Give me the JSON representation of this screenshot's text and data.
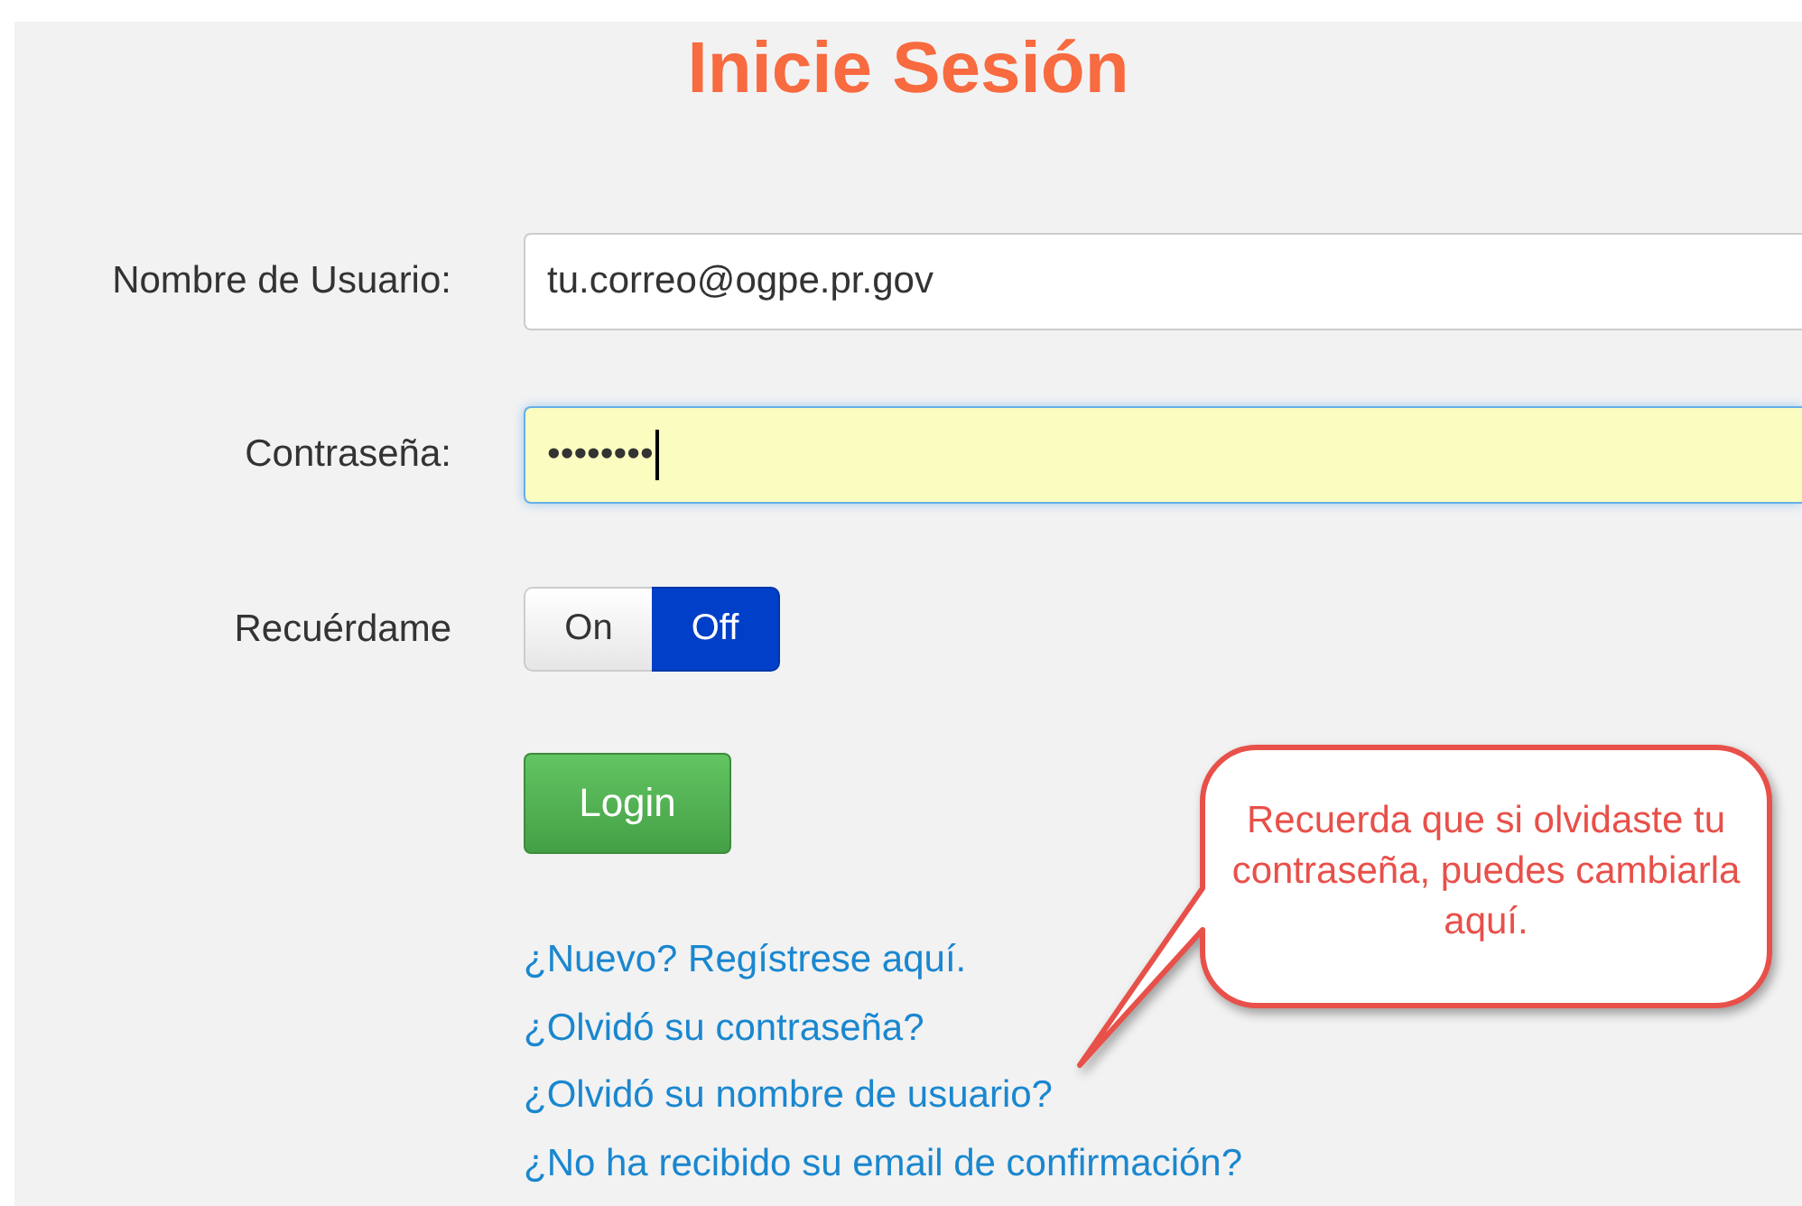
{
  "title": "Inicie Sesión",
  "fields": [
    {
      "label": "Nombre de Usuario:",
      "value": "tu.correo@ogpe.pr.gov",
      "focused": false
    },
    {
      "label": "Contraseña:",
      "value": "••••••••",
      "focused": true
    }
  ],
  "remember": {
    "label": "Recuérdame",
    "options": [
      {
        "label": "On",
        "selected": false
      },
      {
        "label": "Off",
        "selected": true
      }
    ]
  },
  "login_button": "Login",
  "links": [
    "¿Nuevo? Regístrese aquí.",
    "¿Olvidó su contraseña?",
    "¿Olvidó su nombre de usuario?",
    "¿No ha recibido su email de confirmación?"
  ],
  "callout": {
    "text": "Recuerda que si olvidaste tu contraseña, puedes cambiarla aquí."
  }
}
